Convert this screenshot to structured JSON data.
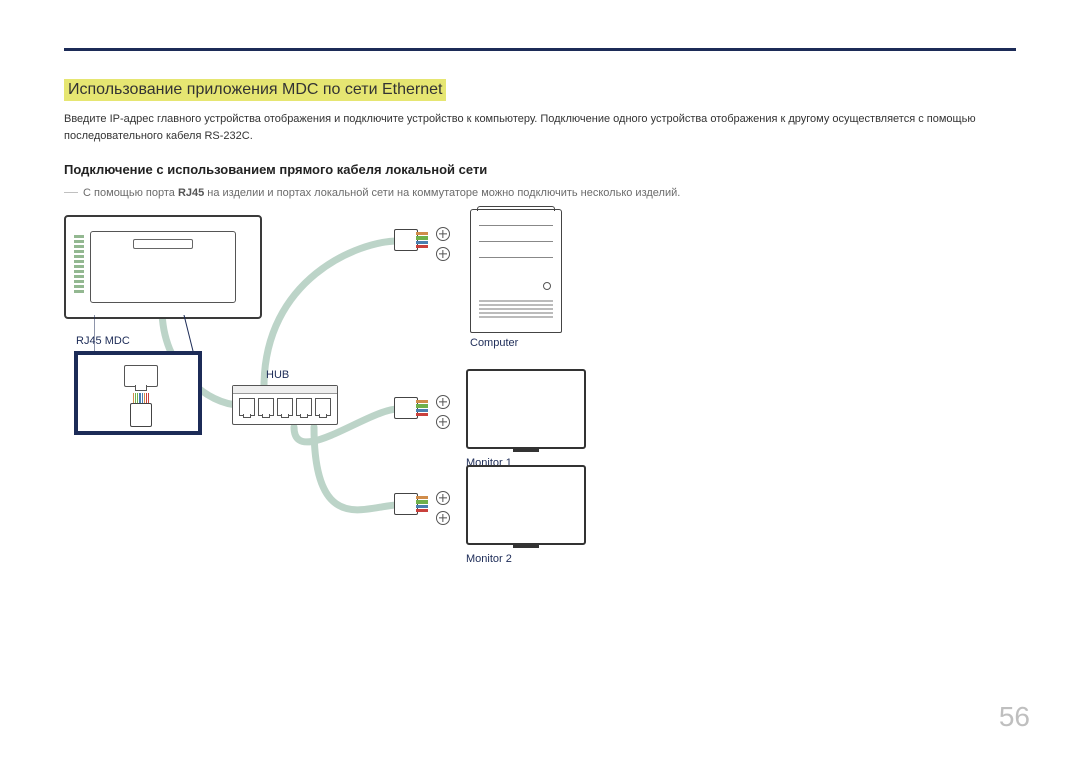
{
  "heading": "Использование приложения MDC по сети Ethernet",
  "intro": "Введите IP-адрес главного устройства отображения и подключите устройство к компьютеру. Подключение одного устройства отображения к другому осуществляется с помощью последовательного кабеля RS-232C.",
  "subheading": "Подключение с использованием прямого кабеля локальной сети",
  "note_prefix": "―",
  "note_text_before_bold": " С помощью порта ",
  "note_bold": "RJ45",
  "note_text_after_bold": " на изделии и портах локальной сети на коммутаторе можно подключить несколько изделий.",
  "labels": {
    "rj45": "RJ45 MDC",
    "hub": "HUB",
    "computer": "Computer",
    "monitor1": "Monitor 1",
    "monitor2": "Monitor 2"
  },
  "page_number": "56"
}
